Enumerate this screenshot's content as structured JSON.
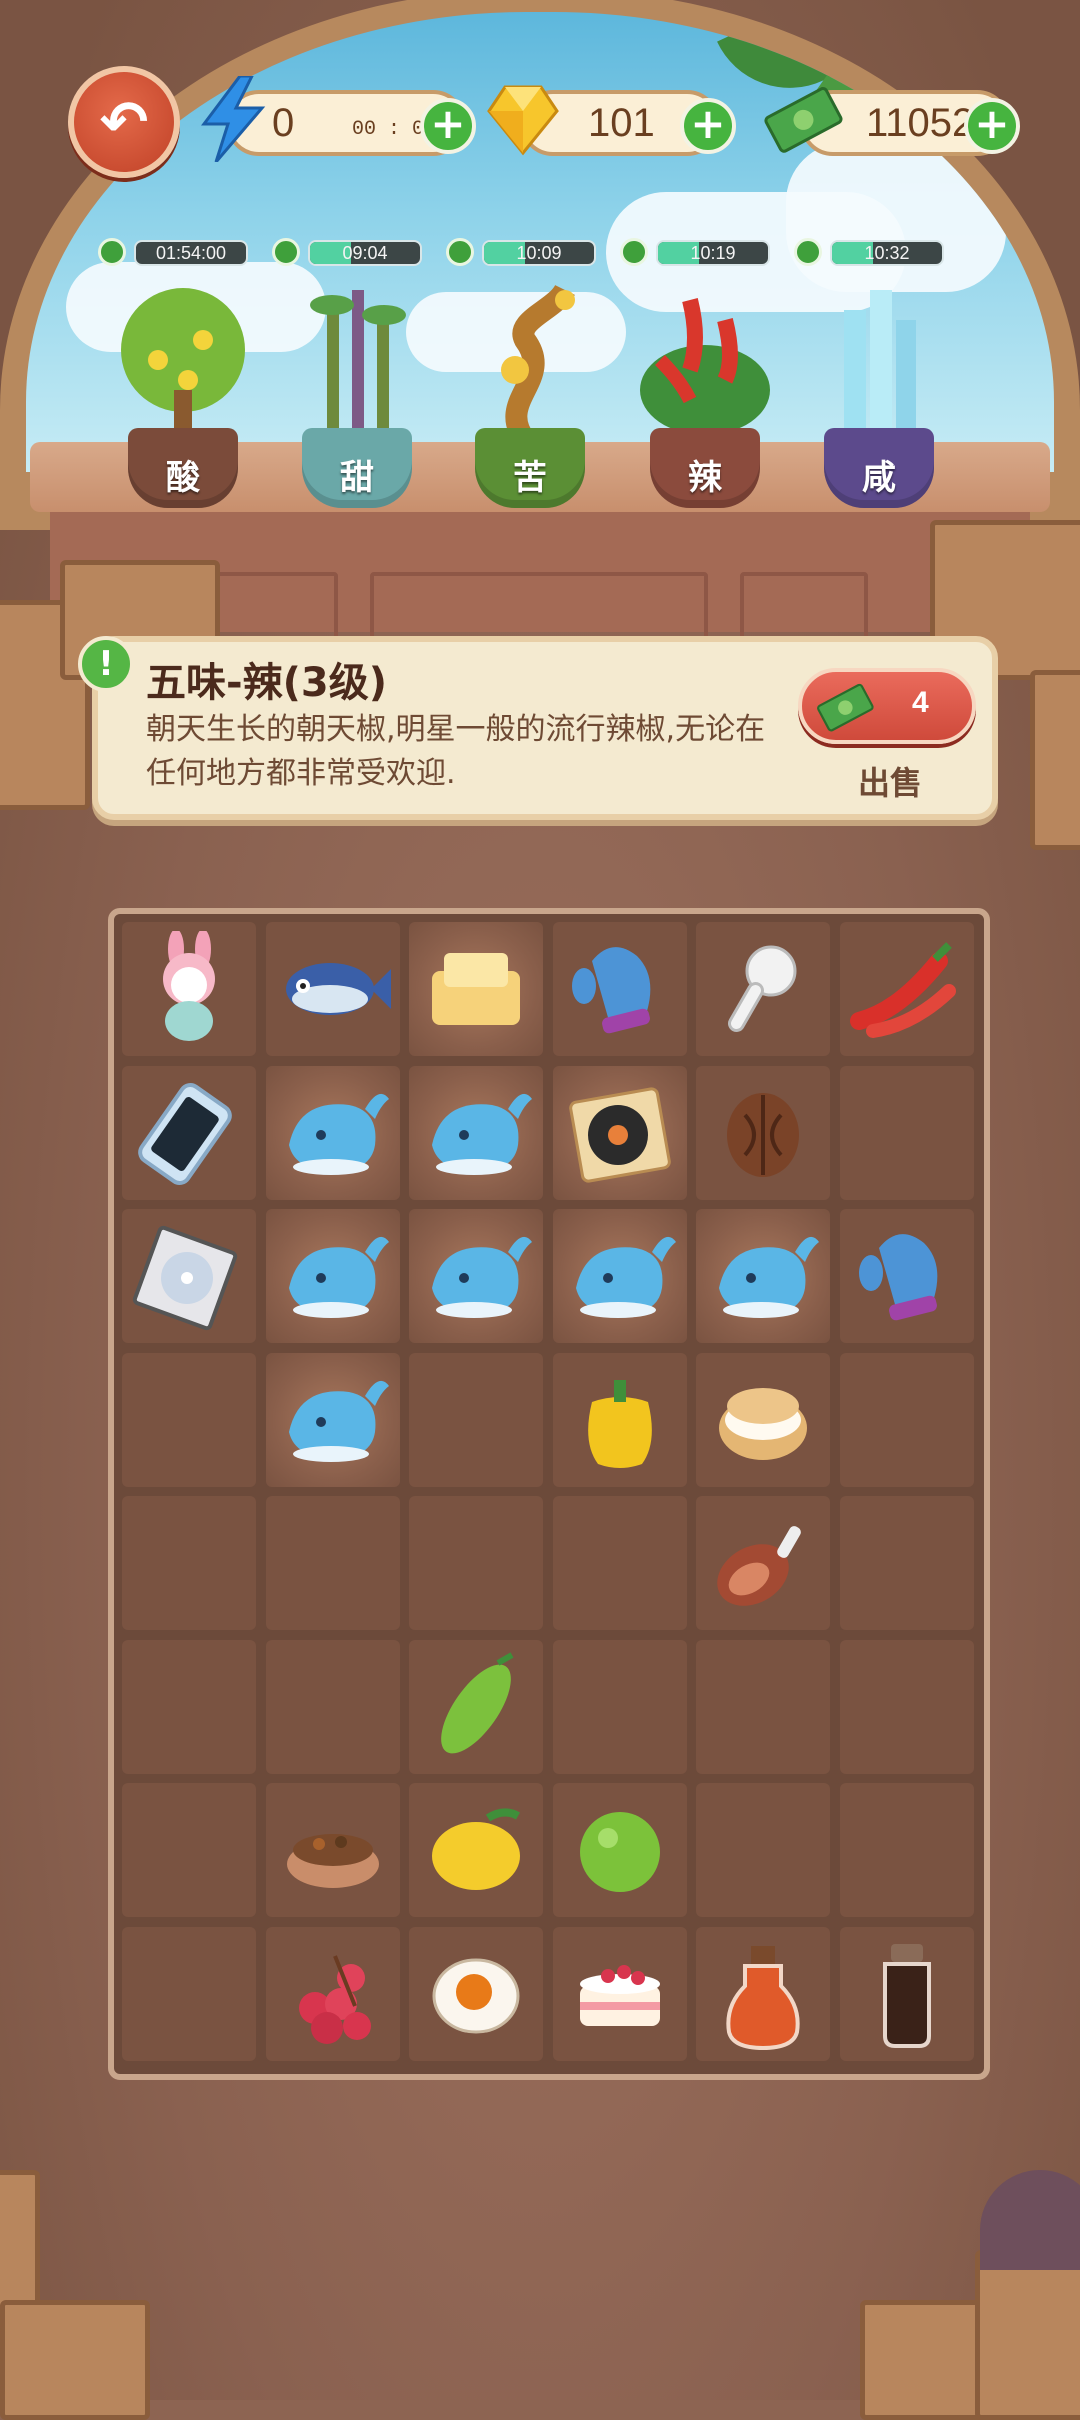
{
  "hud": {
    "energy": {
      "value": "0",
      "timer": "00 : 02",
      "icon": "lightning-icon",
      "plus": "+"
    },
    "gems": {
      "value": "101",
      "icon": "gem-icon",
      "plus": "+"
    },
    "cash": {
      "value": "11052",
      "icon": "cash-icon",
      "plus": "+"
    },
    "back_icon": "↶"
  },
  "plants": [
    {
      "label": "酸",
      "timer": "01:54:00",
      "progress": 0.0,
      "pot_color": "#7b4b3a"
    },
    {
      "label": "甜",
      "timer": "09:04",
      "progress": 0.37,
      "pot_color": "#6aa8a8"
    },
    {
      "label": "苦",
      "timer": "10:09",
      "progress": 0.37,
      "pot_color": "#5b8f35"
    },
    {
      "label": "辣",
      "timer": "10:19",
      "progress": 0.37,
      "pot_color": "#8b4b3d"
    },
    {
      "label": "咸",
      "timer": "10:32",
      "progress": 0.37,
      "pot_color": "#5c4a8c"
    }
  ],
  "info": {
    "badge": "!",
    "title": "五味-辣(3级)",
    "description": "朝天生长的朝天椒,明星一般的流行辣椒,无论在任何地方都非常受欢迎.",
    "sell_price": "4",
    "sell_label": "出售"
  },
  "board": {
    "rows": [
      [
        "bunny-doll",
        "fish",
        "butter",
        "blue-mitten",
        "earbud",
        "red-chili"
      ],
      [
        "smartphone",
        "blue-whale",
        "blue-whale",
        "record-player",
        "walnut",
        ""
      ],
      [
        "cd-case",
        "blue-whale",
        "blue-whale",
        "blue-whale",
        "blue-whale",
        "blue-mitten"
      ],
      [
        "",
        "blue-whale",
        "",
        "yellow-pepper",
        "cream-puff",
        ""
      ],
      [
        "",
        "",
        "",
        "",
        "ham-leg",
        ""
      ],
      [
        "",
        "",
        "bitter-melon",
        "",
        "",
        ""
      ],
      [
        "",
        "spice-bowl",
        "lemon",
        "lime",
        "",
        ""
      ],
      [
        "",
        "lychee",
        "salted-egg",
        "strawberry-cake",
        "vinegar-bottle",
        "soy-sauce-bottle"
      ]
    ]
  }
}
